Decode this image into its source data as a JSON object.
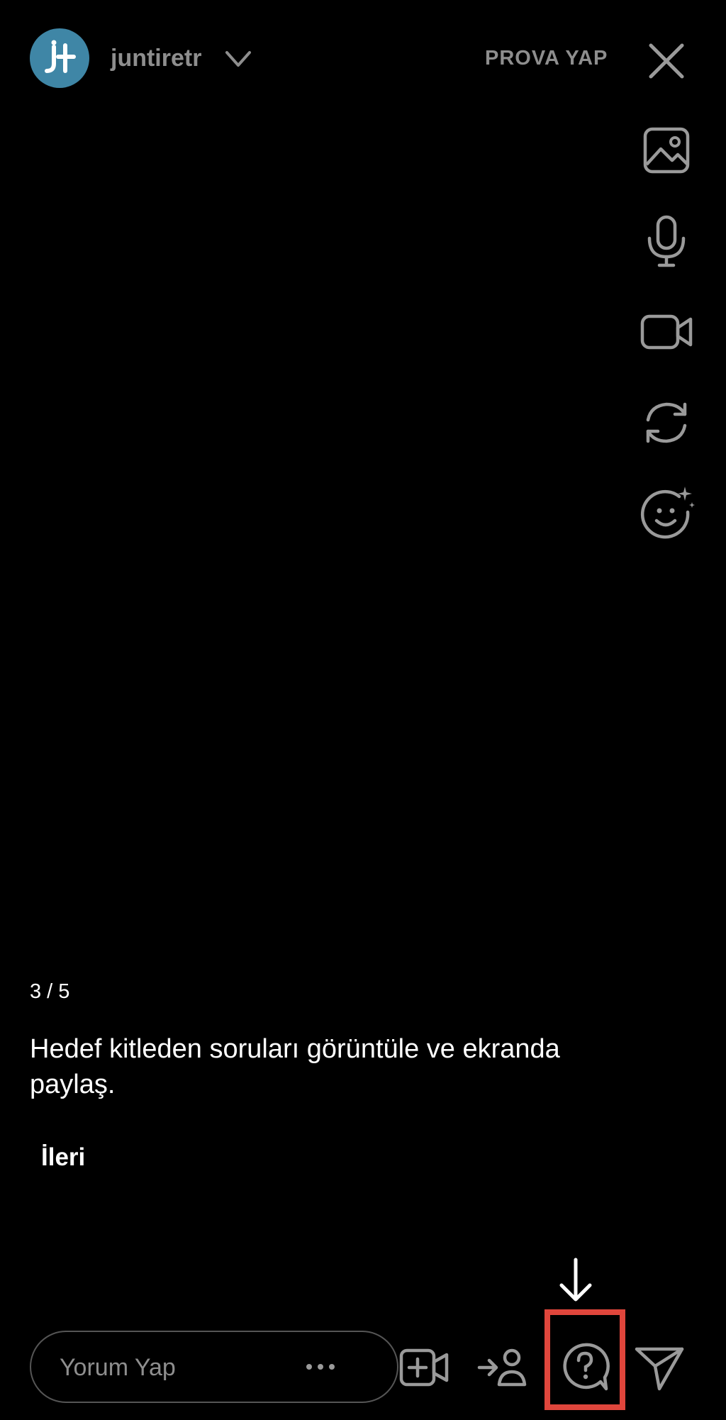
{
  "header": {
    "username": "juntiretr",
    "try_label": "PROVA YAP",
    "icons": {
      "avatar": "juntire-logo",
      "dropdown": "chevron-down-icon",
      "close": "close-icon"
    }
  },
  "side_toolbar": {
    "icons": [
      "image-icon",
      "microphone-icon",
      "video-camera-icon",
      "switch-camera-icon",
      "effects-face-icon"
    ]
  },
  "tutorial": {
    "step": "3 / 5",
    "description": "Hedef kitleden soruları görüntüle ve ekranda paylaş.",
    "next_label": "İleri"
  },
  "bottom_bar": {
    "comment_placeholder": "Yorum Yap",
    "icons": [
      "more-icon",
      "add-video-icon",
      "invite-user-icon",
      "questions-icon",
      "send-icon"
    ]
  },
  "colors": {
    "background": "#000000",
    "muted_text": "#8e8e8e",
    "highlight": "#e0463c",
    "avatar": "#3f86a6"
  }
}
